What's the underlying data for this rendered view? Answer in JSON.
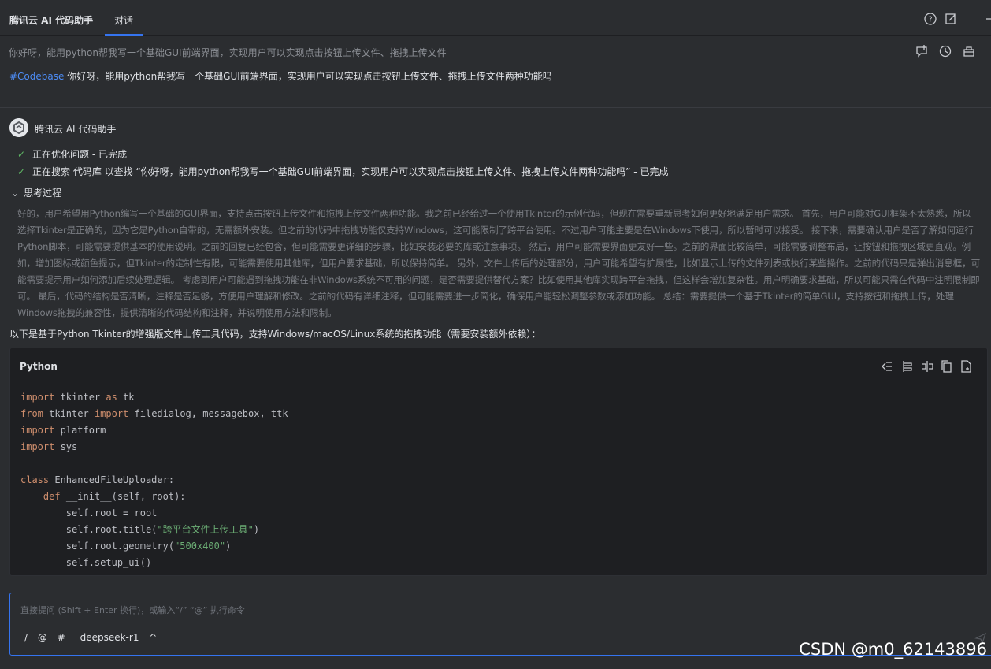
{
  "header": {
    "title": "腾讯云 AI 代码助手",
    "tab": "对话"
  },
  "topic": {
    "title": "你好呀，能用python帮我写一个基础GUI前端界面，实现用户可以实现点击按钮上传文件、拖拽上传文件"
  },
  "user_message": {
    "tag": "#Codebase",
    "text": " 你好呀，能用python帮我写一个基础GUI前端界面，实现用户可以实现点击按钮上传文件、拖拽上传文件两种功能吗"
  },
  "assistant": {
    "name": "腾讯云 AI 代码助手",
    "steps": [
      "正在优化问题 - 已完成",
      "正在搜索 代码库 以查找 “你好呀，能用python帮我写一个基础GUI前端界面，实现用户可以实现点击按钮上传文件、拖拽上传文件两种功能吗” - 已完成"
    ],
    "thinking_label": "思考过程",
    "thinking_text": "好的，用户希望用Python编写一个基础的GUI界面，支持点击按钮上传文件和拖拽上传文件两种功能。我之前已经给过一个使用Tkinter的示例代码，但现在需要重新思考如何更好地满足用户需求。 首先，用户可能对GUI框架不太熟悉，所以选择Tkinter是正确的，因为它是Python自带的，无需额外安装。但之前的代码中拖拽功能仅支持Windows，这可能限制了跨平台使用。不过用户可能主要是在Windows下使用，所以暂时可以接受。 接下来，需要确认用户是否了解如何运行Python脚本，可能需要提供基本的使用说明。之前的回复已经包含，但可能需要更详细的步骤，比如安装必要的库或注意事项。 然后，用户可能需要界面更友好一些。之前的界面比较简单，可能需要调整布局，让按钮和拖拽区域更直观。例如，增加图标或颜色提示，但Tkinter的定制性有限，可能需要使用其他库，但用户要求基础，所以保持简单。 另外，文件上传后的处理部分，用户可能希望有扩展性，比如显示上传的文件列表或执行某些操作。之前的代码只是弹出消息框，可能需要提示用户如何添加后续处理逻辑。 考虑到用户可能遇到拖拽功能在非Windows系统不可用的问题，是否需要提供替代方案？比如使用其他库实现跨平台拖拽，但这样会增加复杂性。用户明确要求基础，所以可能只需在代码中注明限制即可。 最后，代码的结构是否清晰，注释是否足够，方便用户理解和修改。之前的代码有详细注释，但可能需要进一步简化，确保用户能轻松调整参数或添加功能。 总结：需要提供一个基于Tkinter的简单GUI，支持按钮和拖拽上传，处理Windows拖拽的兼容性，提供清晰的代码结构和注释，并说明使用方法和限制。",
    "intro": "以下是基于Python Tkinter的增强版文件上传工具代码，支持Windows/macOS/Linux系统的拖拽功能（需要安装额外依赖）："
  },
  "code_block": {
    "language": "Python",
    "lines": [
      [
        {
          "t": "import",
          "c": "kw"
        },
        {
          "t": " tkinter "
        },
        {
          "t": "as",
          "c": "kw"
        },
        {
          "t": " tk"
        }
      ],
      [
        {
          "t": "from",
          "c": "kw"
        },
        {
          "t": " tkinter "
        },
        {
          "t": "import",
          "c": "kw"
        },
        {
          "t": " filedialog, messagebox, ttk"
        }
      ],
      [
        {
          "t": "import",
          "c": "kw"
        },
        {
          "t": " platform"
        }
      ],
      [
        {
          "t": "import",
          "c": "kw"
        },
        {
          "t": " sys"
        }
      ],
      [],
      [
        {
          "t": "class",
          "c": "kw"
        },
        {
          "t": " EnhancedFileUploader:"
        }
      ],
      [
        {
          "t": "    "
        },
        {
          "t": "def",
          "c": "kw"
        },
        {
          "t": " __init__(self, root):"
        }
      ],
      [
        {
          "t": "        self.root = root"
        }
      ],
      [
        {
          "t": "        self.root.title("
        },
        {
          "t": "\"跨平台文件上传工具\"",
          "c": "str"
        },
        {
          "t": ")"
        }
      ],
      [
        {
          "t": "        self.root.geometry("
        },
        {
          "t": "\"500x400\"",
          "c": "str"
        },
        {
          "t": ")"
        }
      ],
      [
        {
          "t": "        self.setup_ui()"
        }
      ]
    ]
  },
  "input": {
    "placeholder": "直接提问 (Shift + Enter 换行)，或输入“/” “@” 执行命令",
    "tool_slash": "/",
    "tool_at": "@",
    "tool_hash": "#",
    "model": "deepseek-r1",
    "model_chevron": "^"
  },
  "watermark": "CSDN @m0_62143896",
  "colors": {
    "accent": "#3574f0",
    "background": "#2b2d30",
    "code_background": "#1e1f22",
    "check": "#5fb865",
    "tag": "#4d8df7"
  },
  "icons": [
    "help-icon",
    "edit-icon",
    "new-chat-icon",
    "history-icon",
    "toolbox-icon",
    "insert-icon",
    "insert-below-icon",
    "split-icon",
    "copy-icon",
    "new-file-icon",
    "send-icon"
  ]
}
